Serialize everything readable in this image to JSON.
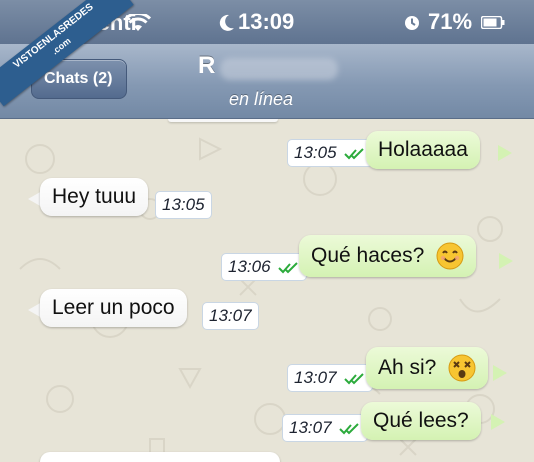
{
  "status_bar": {
    "carrier": "oventi",
    "time": "13:09",
    "battery": "71%"
  },
  "nav": {
    "back_label": "Chats (2)",
    "contact_initial": "R",
    "status": "en línea"
  },
  "watermark": {
    "line1": "VISTOENLASREDES",
    ".com": ".com"
  },
  "messages": [
    {
      "direction": "out",
      "text": "Holaaaaa",
      "time": "13:05",
      "read": true
    },
    {
      "direction": "in",
      "text": "Hey tuuu",
      "time": "13:05"
    },
    {
      "direction": "out",
      "text": "Qué haces?",
      "time": "13:06",
      "read": true,
      "emoji": "smile-emoji"
    },
    {
      "direction": "in",
      "text": "Leer un poco",
      "time": "13:07"
    },
    {
      "direction": "out",
      "text": "Ah si?",
      "time": "13:07",
      "read": true,
      "emoji": "dizzy-emoji"
    },
    {
      "direction": "out",
      "text": "Qué lees?",
      "time": "13:07",
      "read": true
    }
  ],
  "colors": {
    "outgoing_bubble": "#d4f2b3",
    "incoming_bubble": "#ffffff",
    "nav_bar": "#8599b3",
    "read_check": "#2cab3c"
  }
}
